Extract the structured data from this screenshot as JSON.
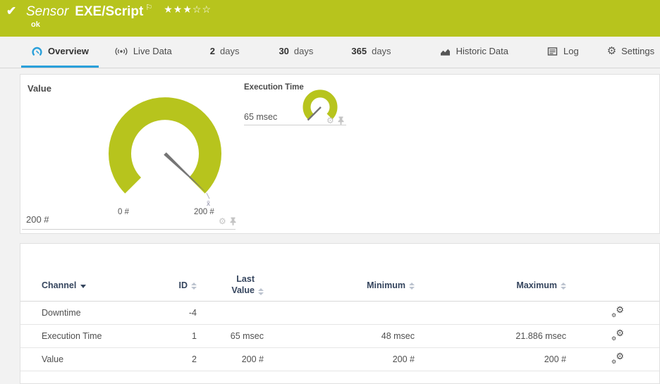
{
  "titlebar": {
    "kind": "Sensor",
    "name": "EXE/Script",
    "status": "ok",
    "check_glyph": "✔",
    "flag_glyph": "⚐",
    "stars_filled": "★★★",
    "stars_empty": "☆☆"
  },
  "tabs": [
    {
      "label": "Overview"
    },
    {
      "label": "Live Data"
    },
    {
      "num": "2",
      "label": "days"
    },
    {
      "num": "30",
      "label": "days"
    },
    {
      "num": "365",
      "label": "days"
    },
    {
      "label": "Historic Data"
    },
    {
      "label": "Log"
    },
    {
      "label": "Settings"
    }
  ],
  "icons": {
    "gear_glyph": "⚙"
  },
  "gauge_value": {
    "title": "Value",
    "scale_min": "0 #",
    "scale_max": "200 #",
    "current": "200 #",
    "mean_marker": "x̄"
  },
  "gauge_execution_time": {
    "title": "Execution Time",
    "current": "65 msec"
  },
  "channel_table": {
    "headers": {
      "channel": "Channel",
      "id": "ID",
      "last_value": "Last Value",
      "minimum": "Minimum",
      "maximum": "Maximum"
    },
    "rows": [
      {
        "channel": "Downtime",
        "id": "-4",
        "last": "",
        "min": "",
        "max": ""
      },
      {
        "channel": "Execution Time",
        "id": "1",
        "last": "65 msec",
        "min": "48 msec",
        "max": "21.886 msec"
      },
      {
        "channel": "Value",
        "id": "2",
        "last": "200 #",
        "min": "200 #",
        "max": "200 #"
      }
    ]
  },
  "colors": {
    "brand_green": "#b7c41d",
    "active_tab_blue": "#2aa0da",
    "needle_gray": "#757575"
  }
}
